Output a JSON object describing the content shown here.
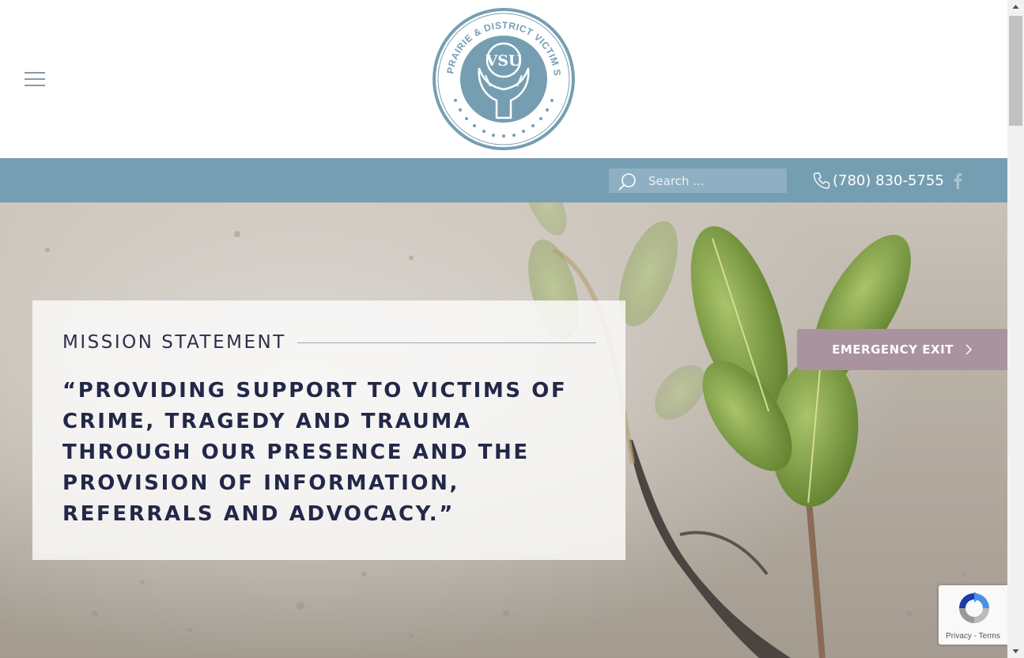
{
  "header": {
    "logo_text": "GRANDE PRAIRIE & DISTRICT VICTIM SERVICES",
    "logo_monogram": "VSU",
    "menu_icon": "hamburger-menu-icon"
  },
  "topbar": {
    "search_placeholder": "Search ...",
    "phone": "(780) 830-5755",
    "social_icon": "facebook-icon"
  },
  "hero": {
    "mission_title": "MISSION STATEMENT",
    "mission_quote": "“PROVIDING SUPPORT TO VICTIMS OF CRIME, TRAGEDY AND TRAUMA THROUGH OUR PRESENCE AND THE PROVISION OF INFORMATION, REFERRALS AND ADVOCACY.”",
    "emergency_label": "EMERGENCY EXIT"
  },
  "recaptcha": {
    "links": "Privacy - Terms"
  },
  "colors": {
    "topbar": "#769eb3",
    "logo": "#769eb3",
    "emergency": "#a8939e",
    "heading": "#232848"
  }
}
